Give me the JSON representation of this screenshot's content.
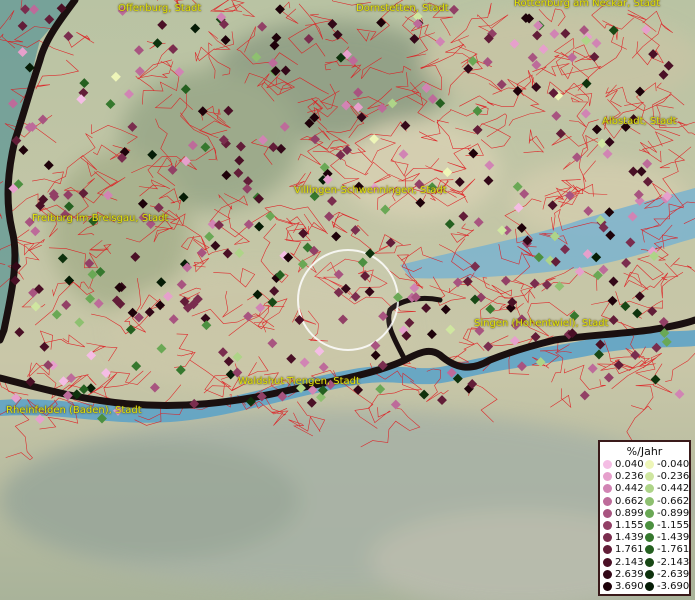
{
  "cities": [
    {
      "name": "Offenburg, Stadt"
    },
    {
      "name": "Dornstetten, Stadt"
    },
    {
      "name": "Rottenburg am Neckar, Stadt"
    },
    {
      "name": "Albstadt, Stadt"
    },
    {
      "name": "Villingen-Schwenningen, Stadt"
    },
    {
      "name": "Freiburg im Breisgau, Stadt"
    },
    {
      "name": "Singen (Hohentwiel), Stadt"
    },
    {
      "name": "Waldshut-Tiengen, Stadt"
    },
    {
      "name": "Rheinfelden (Baden), Stadt"
    }
  ],
  "legend": {
    "title": "%/Jahr",
    "positive": [
      {
        "label": "0.040",
        "color": "#f4bde4"
      },
      {
        "label": "0.236",
        "color": "#e6a0cc"
      },
      {
        "label": "0.442",
        "color": "#d184b4"
      },
      {
        "label": "0.662",
        "color": "#bd6b9a"
      },
      {
        "label": "0.899",
        "color": "#a85480"
      },
      {
        "label": "1.155",
        "color": "#924066"
      },
      {
        "label": "1.439",
        "color": "#7a2d4e"
      },
      {
        "label": "1.761",
        "color": "#621d38"
      },
      {
        "label": "2.143",
        "color": "#4a1026"
      },
      {
        "label": "2.639",
        "color": "#330818"
      },
      {
        "label": "3.690",
        "color": "#1e020a"
      }
    ],
    "negative": [
      {
        "label": "-0.040",
        "color": "#eef6b8"
      },
      {
        "label": "-0.236",
        "color": "#cfe6a0"
      },
      {
        "label": "-0.442",
        "color": "#aed488"
      },
      {
        "label": "-0.662",
        "color": "#8ec070"
      },
      {
        "label": "-0.899",
        "color": "#6aa855"
      },
      {
        "label": "-1.155",
        "color": "#4c9040"
      },
      {
        "label": "-1.439",
        "color": "#36782e"
      },
      {
        "label": "-1.761",
        "color": "#256020"
      },
      {
        "label": "-2.143",
        "color": "#184815"
      },
      {
        "label": "-2.639",
        "color": "#0e320d"
      },
      {
        "label": "-3.690",
        "color": "#061c06"
      }
    ]
  },
  "colors": {
    "label_text": "#e2e40c",
    "borders": "#e0191e",
    "water": "#5ea3c7",
    "state_border": "#1a1010"
  }
}
